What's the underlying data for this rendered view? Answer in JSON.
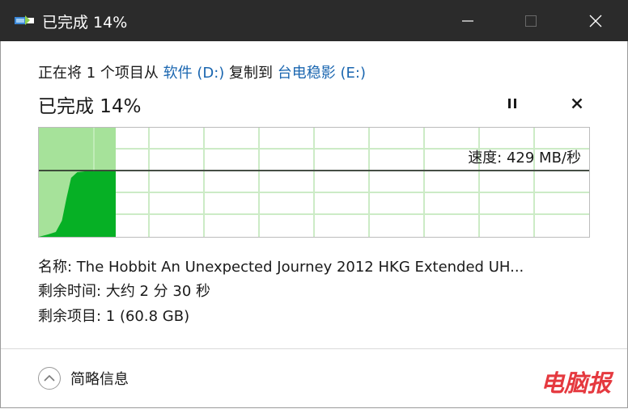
{
  "window": {
    "title": "已完成 14%"
  },
  "copy_line": {
    "prefix": "正在将 1 个项目从 ",
    "source": "软件 (D:)",
    "middle": " 复制到 ",
    "destination": "台电稳影 (E:)"
  },
  "progress": {
    "title": "已完成 14%",
    "fraction": 0.14,
    "speed": "速度: 429 MB/秒"
  },
  "details": {
    "name": "名称: The Hobbit An Unexpected Journey 2012 HKG Extended UH...",
    "time_remaining": "剩余时间: 大约 2 分 30 秒",
    "items_remaining": "剩余项目: 1 (60.8 GB)"
  },
  "footer": {
    "toggle_label": "简略信息"
  },
  "watermark": {
    "text": "电脑报"
  },
  "colors": {
    "titlebar_bg": "#2b2b2b",
    "graph_fill_light": "#a6e29a",
    "graph_fill_dark": "#06b025",
    "graph_border": "#bcbcbc",
    "grid": "#ccebc6",
    "link": "#1a66b0",
    "watermark": "#e5393f"
  },
  "icons": {
    "app": "copy-progress-icon",
    "pause": "pause-icon",
    "cancel": "close-icon",
    "toggle": "chevron-up-icon"
  }
}
